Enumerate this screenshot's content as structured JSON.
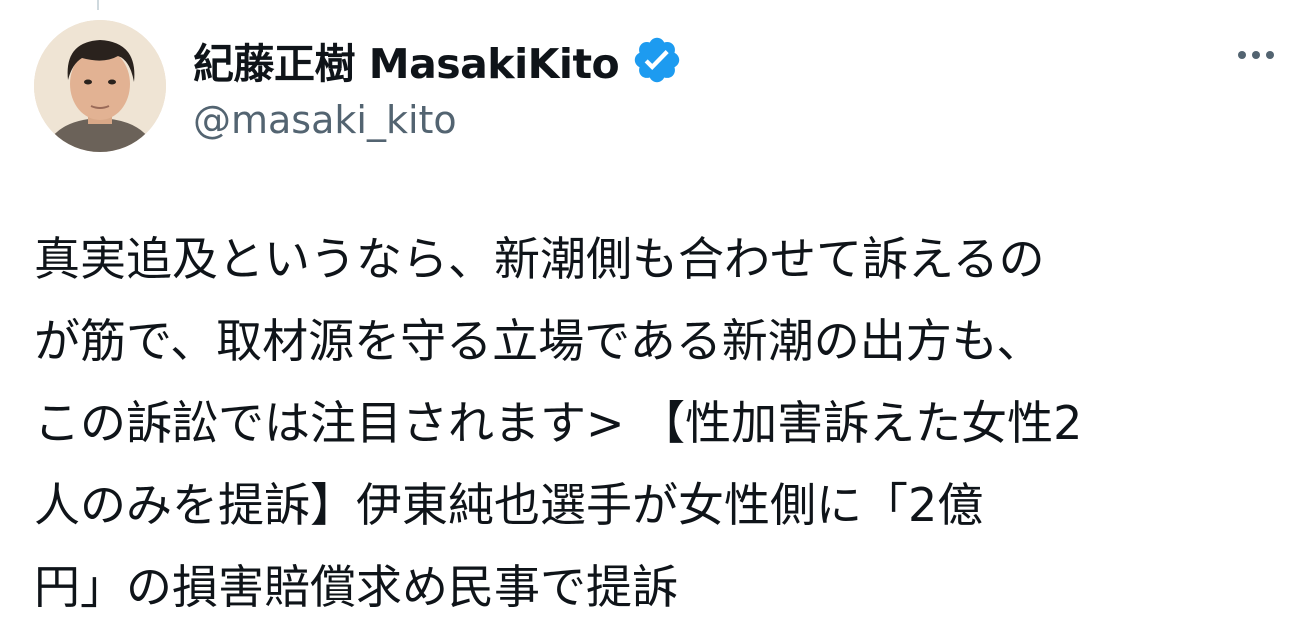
{
  "tweet": {
    "author": {
      "display_name": "紀藤正樹 MasakiKito",
      "handle": "@masaki_kito",
      "verified": true,
      "verified_color": "#1d9bf0",
      "avatar_icon": "profile-photo"
    },
    "more_icon": "more-horizontal-icon",
    "text_lines": [
      "真実追及というなら、新潮側も合わせて訴えるの",
      "が筋で、取材源を守る立場である新潮の出方も、",
      "この訴訟では注目されます> 【性加害訴えた女性2",
      "人のみを提訴】伊東純也選手が女性側に「2億",
      "円」の損害賠償求め民事で提訴"
    ]
  },
  "colors": {
    "text_primary": "#0f1419",
    "text_secondary": "#536471",
    "background": "#ffffff"
  }
}
